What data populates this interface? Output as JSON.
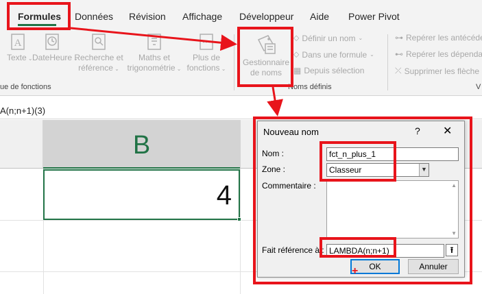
{
  "tabs": {
    "formules": "Formules",
    "donnees": "Données",
    "revision": "Révision",
    "affichage": "Affichage",
    "developpeur": "Développeur",
    "aide": "Aide",
    "power_pivot": "Power Pivot"
  },
  "ribbon": {
    "texte": "Texte",
    "dateheure": "DateHeure",
    "recherche_line1": "Recherche et",
    "recherche_line2": "référence",
    "maths_line1": "Maths et",
    "maths_line2": "trigonométrie",
    "plus_line1": "Plus de",
    "plus_line2": "fonctions",
    "gestionnaire_line1": "Gestionnaire",
    "gestionnaire_line2": "de noms",
    "definir_nom": "Définir un nom",
    "dans_formule": "Dans une formule",
    "depuis_selection": "Depuis sélection",
    "reperer_antecedents": "Repérer les antécéde",
    "reperer_dependants": "Repérer les dépendan",
    "supprimer_fleches": "Supprimer les flèche",
    "group_fonctions": "ue de fonctions",
    "group_noms": "Noms définis",
    "group_v": "V"
  },
  "formula_bar": {
    "text": "A(n;n+1)(3)"
  },
  "grid": {
    "column_b": "B",
    "cell_b1_value": "4"
  },
  "dialog": {
    "title": "Nouveau nom",
    "help": "?",
    "close": "✕",
    "nom_label": "Nom :",
    "nom_value": "fct_n_plus_1",
    "zone_label": "Zone :",
    "zone_value": "Classeur",
    "commentaire_label": "Commentaire :",
    "fait_ref_label": "Fait référence à :",
    "fait_ref_value": "LAMBDA(n;n+1)",
    "ok": "OK",
    "annuler": "Annuler"
  },
  "colors": {
    "annotation_red": "#e8141b",
    "excel_green": "#217346"
  }
}
